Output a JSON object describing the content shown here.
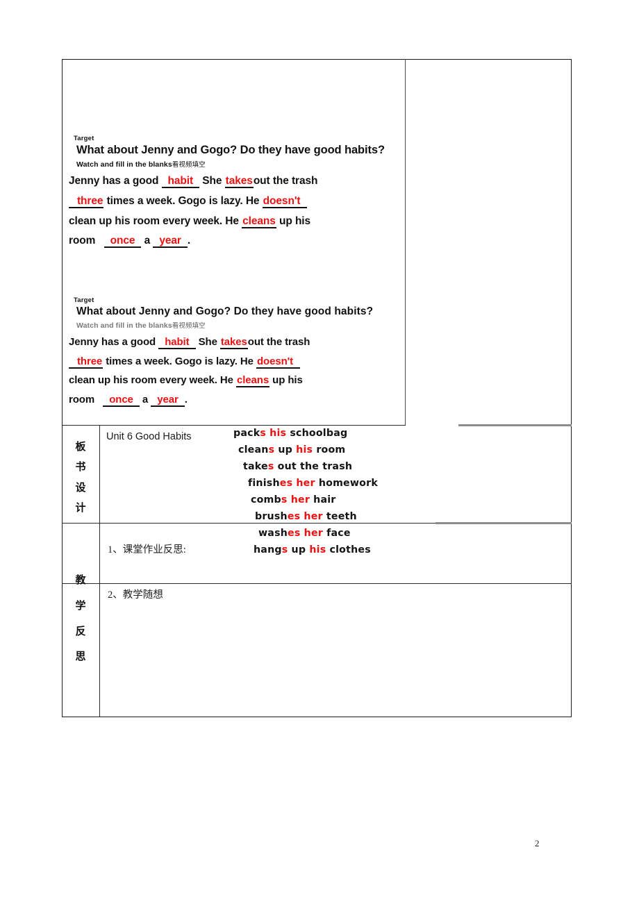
{
  "document": {
    "page_number": "2"
  },
  "slides": [
    {
      "target_label": "Target",
      "question": "What about Jenny and Gogo? Do they have good habits?",
      "instruction_en": "Watch and fill in the blanks",
      "instruction_cn": "看视频填空",
      "passage": {
        "seg1": "Jenny has a good",
        "blank1": "habit",
        "seg2": "She",
        "blank2": "takes",
        "seg3": "out the trash",
        "blank3": "three",
        "seg4": "times a week. Gogo is lazy. He",
        "blank4": "doesn't",
        "seg5": "clean up his room every week. He",
        "blank5": "cleans",
        "seg6": "up his",
        "seg7": "room",
        "blank6": "once",
        "seg8": "a",
        "blank7": "year",
        "seg9": "."
      }
    },
    {
      "target_label": "Target",
      "question": "What about Jenny and Gogo? Do they have good habits?",
      "instruction_en": "Watch and fill in the blanks",
      "instruction_cn": "看视频填空",
      "passage": {
        "seg1": "Jenny has a good",
        "blank1": "habit",
        "seg2": "She",
        "blank2": "takes",
        "seg3": "out the trash",
        "blank3": "three",
        "seg4": "times a week. Gogo is lazy. He",
        "blank4": "doesn't",
        "seg5": "clean up his room every week. He",
        "blank5": "cleans",
        "seg6": "up his",
        "seg7": "room",
        "blank6": "once",
        "seg8": "a",
        "blank7": "year",
        "seg9": "."
      }
    }
  ],
  "table": {
    "blackboard_row": {
      "label_chars": [
        "板",
        "书",
        "设",
        "计"
      ],
      "unit_title": "Unit 6 Good Habits"
    },
    "reflection_row": {
      "label_chars": [
        "教",
        "学",
        "反",
        "思"
      ],
      "item1": "1、课堂作业反思:",
      "item2": "2、教学随想"
    }
  },
  "phrases": [
    {
      "pre": "pack",
      "suffix": "s",
      "mid": " ",
      "pron": "his",
      "post": " schoolbag",
      "indent": 0
    },
    {
      "pre": "clean",
      "suffix": "s",
      "mid": " up ",
      "pron": "his",
      "post": " room",
      "indent": 7
    },
    {
      "pre": "take",
      "suffix": "s",
      "mid": " out the trash",
      "pron": "",
      "post": "",
      "indent": 14
    },
    {
      "pre": "finish",
      "suffix": "es",
      "mid": " ",
      "pron": "her",
      "post": " homework",
      "indent": 21
    },
    {
      "pre": "comb",
      "suffix": "s",
      "mid": " ",
      "pron": "her",
      "post": " hair",
      "indent": 25
    },
    {
      "pre": "brush",
      "suffix": "es",
      "mid": " ",
      "pron": "her",
      "post": " teeth",
      "indent": 31
    },
    {
      "pre": "wash",
      "suffix": "es",
      "mid": " ",
      "pron": "her",
      "post": " face",
      "indent": 36
    },
    {
      "pre": "hang",
      "suffix": "s",
      "mid": " up ",
      "pron": "his",
      "post": " clothes",
      "indent": 29
    }
  ],
  "colors": {
    "answer_red": "#ee1111",
    "table_border": "#1a1a1a",
    "gray_rule": "#8c8c8c"
  }
}
